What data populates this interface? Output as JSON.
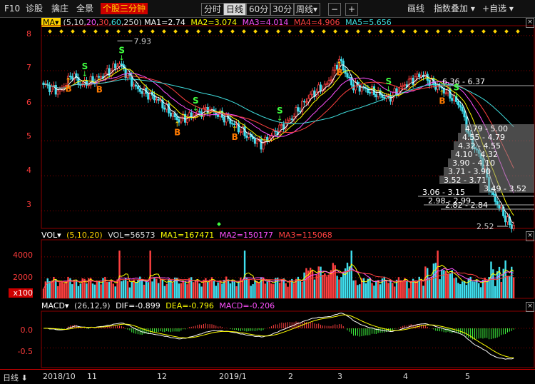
{
  "toolbar": {
    "f10": "F10",
    "items": [
      "诊股",
      "擒庄",
      "全景"
    ],
    "highlight": "个股三分钟",
    "periods": [
      "分时",
      "日线",
      "60分",
      "30分",
      "周线▾"
    ],
    "active_period": "日线",
    "minus": "−",
    "plus": "+",
    "right_items": [
      "画线",
      "指数叠加 ▾",
      "+自选 ▾"
    ]
  },
  "ma_header": {
    "label": "MA▾",
    "params_prefix": "(5,10,",
    "p20": "20",
    "p30": "30",
    "p60": "60",
    "p250": "250)",
    "ma1": "MA1=2.74",
    "ma2": "MA2=3.074",
    "ma3": "MA3=4.014",
    "ma4": "MA4=4.906",
    "ma5": "MA5=5.656"
  },
  "vol_header": {
    "label": "VOL▾",
    "params": "(5,10,20)",
    "vol": "VOL=56573",
    "ma1": "MA1=167471",
    "ma2": "MA2=150177",
    "ma3": "MA3=115068"
  },
  "macd_header": {
    "label": "MACD▾",
    "params": "(26,12,9)",
    "dif": "DIF=-0.899",
    "dea": "DEA=-0.796",
    "macd": "MACD=-0.206"
  },
  "price_axis": [
    "8",
    "7",
    "6",
    "5",
    "4",
    "3"
  ],
  "vol_axis": [
    "4000",
    "2000",
    "x100"
  ],
  "macd_axis": [
    "0.0",
    "-0.5"
  ],
  "bottom": {
    "label": "日线 ⬇",
    "dates": [
      "2018/10",
      "11",
      "12",
      "2019/1",
      "2",
      "3",
      "4",
      "5"
    ]
  },
  "annotations": {
    "high": "7.93",
    "low": "2.52",
    "gaps": [
      "6.36 - 6.37",
      "4.79 - 5.00",
      "4.55 - 4.79",
      "4.32 - 4.55",
      "4.10 - 4.32",
      "3.90 - 4.10",
      "3.71 - 3.90",
      "3.52 - 3.71",
      "3.49 - 3.52",
      "3.06 - 3.15",
      "2.98 - 2.99",
      "2.82 - 2.84"
    ]
  },
  "signals": [
    {
      "t": "B",
      "i": 12
    },
    {
      "t": "S",
      "i": 20
    },
    {
      "t": "B",
      "i": 27
    },
    {
      "t": "S",
      "i": 38
    },
    {
      "t": "B",
      "i": 65
    },
    {
      "t": "S",
      "i": 74
    },
    {
      "t": "B",
      "i": 93
    },
    {
      "t": "S",
      "i": 115
    },
    {
      "t": "B",
      "i": 144
    },
    {
      "t": "S",
      "i": 168
    },
    {
      "t": "B",
      "i": 194
    },
    {
      "t": "S",
      "i": 201
    }
  ],
  "colors": {
    "up": "#ff4040",
    "down": "#40e0f0",
    "ma1": "#ffffff",
    "ma2": "#ffff00",
    "ma3": "#ff50ff",
    "ma4": "#ff4040",
    "ma5": "#40e0e0",
    "grid": "#8b0000",
    "dea": "#ffff00",
    "dif": "#ffffff",
    "macd_down": "#40ff40"
  },
  "chart_data": {
    "type": "candlestick",
    "ylim": [
      2.5,
      8.2
    ],
    "vol_ylim": [
      0,
      5500
    ],
    "macd_ylim": [
      -1.0,
      0.4
    ],
    "key_points": [
      {
        "i": 0,
        "p": 6.6
      },
      {
        "i": 8,
        "p": 6.4
      },
      {
        "i": 14,
        "p": 6.9
      },
      {
        "i": 18,
        "p": 6.6
      },
      {
        "i": 24,
        "p": 6.7
      },
      {
        "i": 30,
        "p": 6.9
      },
      {
        "i": 37,
        "p": 7.2
      },
      {
        "i": 45,
        "p": 6.5
      },
      {
        "i": 55,
        "p": 6.2
      },
      {
        "i": 65,
        "p": 5.6
      },
      {
        "i": 72,
        "p": 5.7
      },
      {
        "i": 80,
        "p": 5.9
      },
      {
        "i": 90,
        "p": 5.6
      },
      {
        "i": 98,
        "p": 5.2
      },
      {
        "i": 106,
        "p": 4.9
      },
      {
        "i": 112,
        "p": 5.2
      },
      {
        "i": 120,
        "p": 5.6
      },
      {
        "i": 130,
        "p": 6.3
      },
      {
        "i": 138,
        "p": 6.6
      },
      {
        "i": 144,
        "p": 7.3
      },
      {
        "i": 150,
        "p": 6.6
      },
      {
        "i": 160,
        "p": 6.4
      },
      {
        "i": 168,
        "p": 6.2
      },
      {
        "i": 176,
        "p": 6.6
      },
      {
        "i": 184,
        "p": 6.9
      },
      {
        "i": 190,
        "p": 6.6
      },
      {
        "i": 196,
        "p": 6.4
      },
      {
        "i": 203,
        "p": 6.0
      },
      {
        "i": 208,
        "p": 5.0
      },
      {
        "i": 213,
        "p": 4.5
      },
      {
        "i": 218,
        "p": 3.5
      },
      {
        "i": 222,
        "p": 3.1
      },
      {
        "i": 227,
        "p": 2.6
      }
    ],
    "ma_last": {
      "ma1": 2.74,
      "ma2": 3.074,
      "ma3": 4.014,
      "ma4": 4.906,
      "ma5": 5.656
    }
  }
}
